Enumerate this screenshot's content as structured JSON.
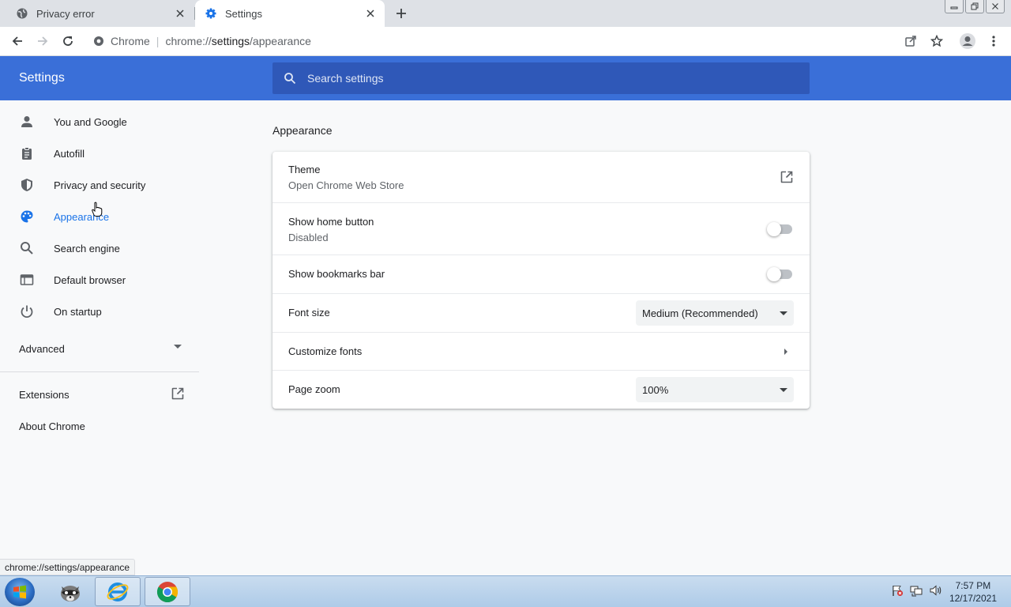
{
  "browser": {
    "tabs": [
      {
        "title": "Privacy error",
        "active": false,
        "icon": "globe-icon"
      },
      {
        "title": "Settings",
        "active": true,
        "icon": "gear-icon"
      }
    ],
    "omnibox": {
      "site_label": "Chrome",
      "url_prefix": "chrome://",
      "url_host": "settings",
      "url_path": "/appearance"
    }
  },
  "settings": {
    "title": "Settings",
    "search_placeholder": "Search settings",
    "nav": [
      {
        "label": "You and Google",
        "icon": "person-icon",
        "selected": false
      },
      {
        "label": "Autofill",
        "icon": "clipboard-icon",
        "selected": false
      },
      {
        "label": "Privacy and security",
        "icon": "shield-icon",
        "selected": false
      },
      {
        "label": "Appearance",
        "icon": "palette-icon",
        "selected": true
      },
      {
        "label": "Search engine",
        "icon": "search-icon",
        "selected": false
      },
      {
        "label": "Default browser",
        "icon": "browser-window-icon",
        "selected": false
      },
      {
        "label": "On startup",
        "icon": "power-icon",
        "selected": false
      }
    ],
    "advanced_label": "Advanced",
    "extensions_label": "Extensions",
    "about_label": "About Chrome"
  },
  "appearance": {
    "section_title": "Appearance",
    "theme": {
      "label": "Theme",
      "sublabel": "Open Chrome Web Store"
    },
    "home_button": {
      "label": "Show home button",
      "sublabel": "Disabled",
      "enabled": false
    },
    "bookmarks_bar": {
      "label": "Show bookmarks bar",
      "enabled": false
    },
    "font_size": {
      "label": "Font size",
      "value": "Medium (Recommended)"
    },
    "customize_fonts": {
      "label": "Customize fonts"
    },
    "page_zoom": {
      "label": "Page zoom",
      "value": "100%"
    }
  },
  "status_url": "chrome://settings/appearance",
  "taskbar": {
    "time": "7:57 PM",
    "date": "12/17/2021"
  },
  "colors": {
    "header_blue": "#3a6fd8",
    "search_bg": "#2f58b8",
    "selected_nav": "#1a73e8"
  }
}
